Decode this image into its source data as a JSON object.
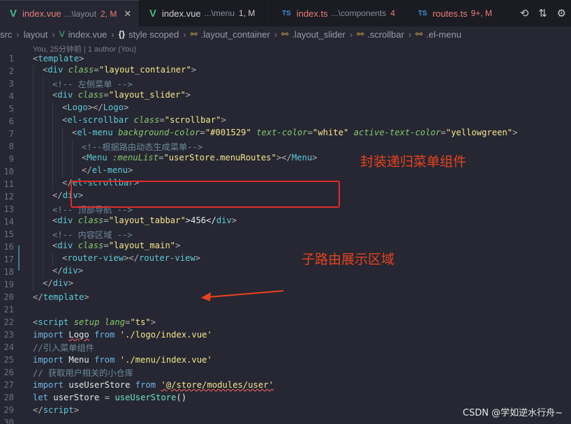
{
  "tabs": [
    {
      "icon": "V",
      "name": "index.vue",
      "path": "...\\layout",
      "badge": "2, M",
      "active": true,
      "modified": true,
      "close": "✕"
    },
    {
      "icon": "V",
      "name": "index.vue",
      "path": "...\\menu",
      "badge": "1, M",
      "active": false,
      "modified": false
    },
    {
      "icon": "TS",
      "name": "index.ts",
      "path": "...\\components",
      "badge": "4",
      "active": false,
      "modified": true
    },
    {
      "icon": "TS",
      "name": "routes.ts",
      "badge": "9+, M",
      "active": false,
      "modified": true
    }
  ],
  "breadcrumb": [
    "src",
    "layout",
    "index.vue",
    "style scoped",
    ".layout_container",
    ".layout_slider",
    ".scrollbar",
    ".el-menu"
  ],
  "breadcrumb_icons": {
    "file": "vue-icon",
    "style": "{}",
    "selector": "selector-icon"
  },
  "blame": "You, 25分钟前 | 1 author (You)",
  "line_numbers": [
    "1",
    "2",
    "3",
    "4",
    "5",
    "6",
    "7",
    "8",
    "9",
    "10",
    "11",
    "12",
    "13",
    "14",
    "15",
    "16",
    "17",
    "18",
    "19",
    "20",
    "21",
    "22",
    "23",
    "24",
    "25",
    "26",
    "27",
    "28",
    "29",
    "30"
  ],
  "code": {
    "l1": [
      "<",
      "template",
      ">"
    ],
    "l2": [
      "<",
      "div",
      "class",
      "=",
      "\"layout_container\"",
      ">"
    ],
    "l3": "<!-- 左侧菜单 -->",
    "l4": [
      "<",
      "div",
      "class",
      "=",
      "\"layout_slider\"",
      ">"
    ],
    "l5": [
      "<",
      "Logo",
      "></",
      "Logo",
      ">"
    ],
    "l6": [
      "<",
      "el-scrollbar",
      "class",
      "=",
      "\"scrollbar\"",
      ">"
    ],
    "l7": [
      "<",
      "el-menu",
      "background-color",
      "=",
      "\"#001529\"",
      "text-color",
      "=",
      "\"white\"",
      "active-text-color",
      "=",
      "\"yellowgreen\"",
      ">"
    ],
    "l8": "<!--根据路由动态生成菜单-->",
    "l9": [
      "<",
      "Menu",
      ":menuList",
      "=",
      "\"userStore.menuRoutes\"",
      "></",
      "Menu",
      ">"
    ],
    "l10": [
      "</",
      "el-menu",
      ">"
    ],
    "l11": [
      "</",
      "el-scrollbar",
      ">"
    ],
    "l12": [
      "</",
      "div",
      ">"
    ],
    "l13": "<!-- 顶部导航 -->",
    "l14": [
      "<",
      "div",
      "class",
      "=",
      "\"layout_tabbar\"",
      ">456</",
      "div",
      ">"
    ],
    "l15": "<!-- 内容区域 -->",
    "l16": [
      "<",
      "div",
      "class",
      "=",
      "\"layout_main\"",
      ">"
    ],
    "l17": [
      "<",
      "router-view",
      "></",
      "router-view",
      ">"
    ],
    "l18": [
      "</",
      "div",
      ">"
    ],
    "l19": [
      "</",
      "div",
      ">"
    ],
    "l20": [
      "</",
      "template",
      ">"
    ],
    "l22": [
      "<",
      "script",
      "setup",
      "lang",
      "=",
      "\"ts\"",
      ">"
    ],
    "l23": [
      "import",
      "Logo",
      "from",
      "'./logo/index.vue'"
    ],
    "l24": "//引入菜单组件",
    "l25": [
      "import",
      "Menu",
      "from",
      "'./menu/index.vue'"
    ],
    "l26": "// 获取用户相关的小仓库",
    "l27": [
      "import",
      "useUserStore",
      "from",
      "'@/store/modules/user'"
    ],
    "l28": [
      "let",
      "userStore",
      "=",
      "useUserStore",
      "()"
    ],
    "l29": [
      "</",
      "script",
      ">"
    ]
  },
  "annotations": {
    "menu_note": "封装递归菜单组件",
    "view_note": "子路由展示区域"
  },
  "watermark": "CSDN @学如逆水行舟~",
  "colors": {
    "annotation": "#e8421e",
    "box": "#e02b2b"
  }
}
